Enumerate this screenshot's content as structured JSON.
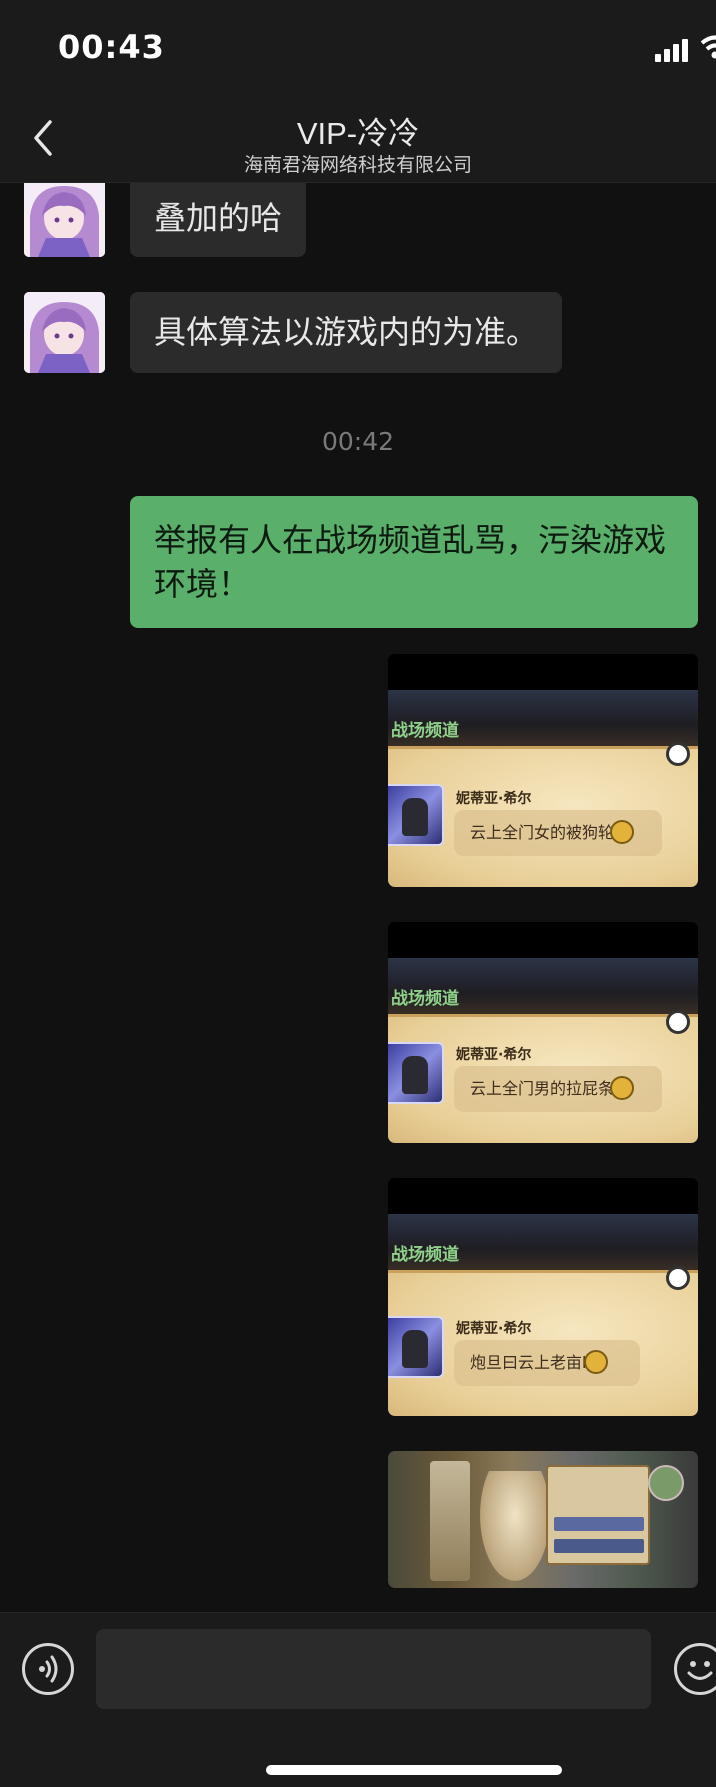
{
  "status_bar": {
    "time": "00:43"
  },
  "nav": {
    "title": "VIP-冷冷",
    "subtitle": "海南君海网络科技有限公司"
  },
  "messages": [
    {
      "from": "contact",
      "text": "叠加的哈"
    },
    {
      "from": "contact",
      "text": "具体算法以游戏内的为准。"
    },
    {
      "type": "timestamp",
      "text": "00:42"
    },
    {
      "from": "me",
      "text": "举报有人在战场频道乱骂，污染游戏环境！"
    }
  ],
  "screenshots": [
    {
      "channel": "战场频道",
      "player": "妮蒂亚·希尔",
      "chat": "云上全门女的被狗轮"
    },
    {
      "channel": "战场频道",
      "player": "妮蒂亚·希尔",
      "chat": "云上全门男的拉屁条"
    },
    {
      "channel": "战场频道",
      "player": "妮蒂亚·希尔",
      "chat": "炮旦曰云上老亩b"
    }
  ],
  "icons": {
    "back": "chevron-left-icon",
    "voice": "voice-icon",
    "emoji": "emoji-icon",
    "signal": "signal-icon",
    "wifi": "wifi-icon"
  },
  "colors": {
    "outgoing_bubble": "#5aaf6a",
    "incoming_bubble": "#2b2b2b",
    "background": "#111111"
  }
}
